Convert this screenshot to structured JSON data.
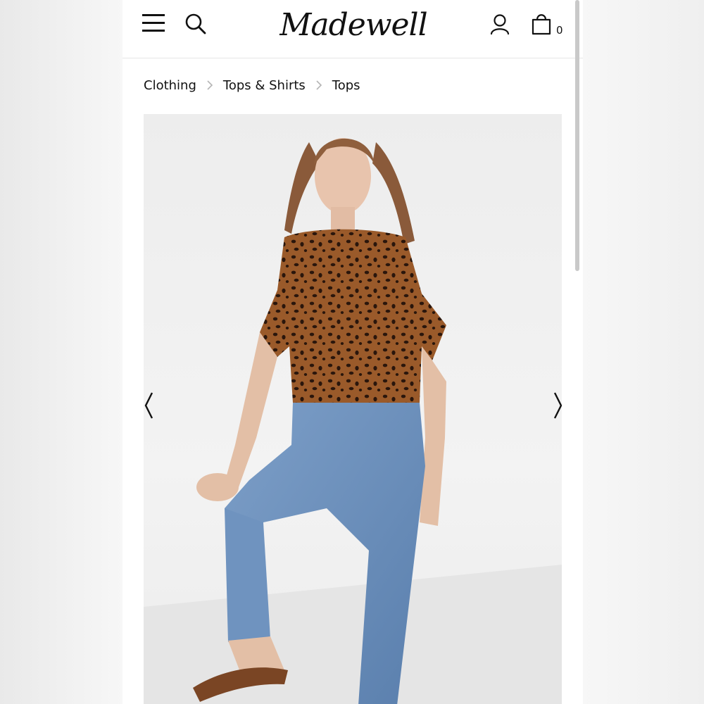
{
  "header": {
    "logo_text": "Madewell",
    "bag_count": "0",
    "icons": {
      "menu": "hamburger-menu-icon",
      "search": "search-icon",
      "account": "user-icon",
      "bag": "shopping-bag-icon"
    }
  },
  "breadcrumb": {
    "items": [
      "Clothing",
      "Tops & Shirts",
      "Tops"
    ]
  },
  "gallery": {
    "prev_icon": "chevron-left-icon",
    "next_icon": "chevron-right-icon"
  },
  "colors": {
    "text": "#111111",
    "divider": "#e6e6e6",
    "background": "#ffffff"
  }
}
